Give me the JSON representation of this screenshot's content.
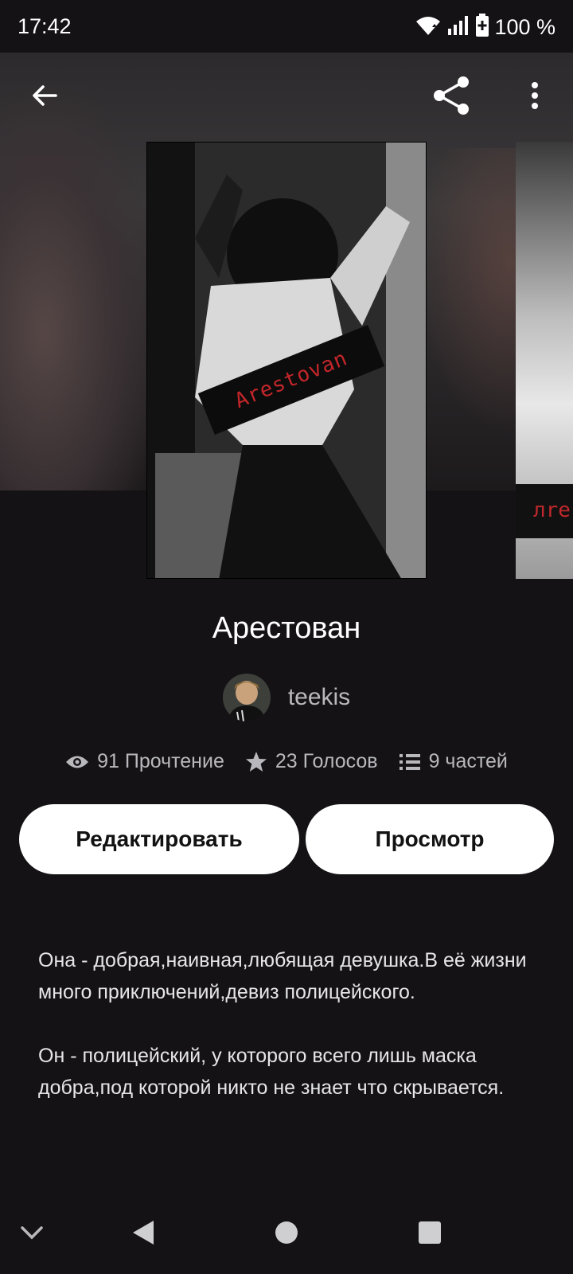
{
  "status_bar": {
    "time": "17:42",
    "battery_text": "100 %",
    "icons": [
      "wifi-icon",
      "cell-signal-icon",
      "battery-icon"
    ]
  },
  "top_nav": {
    "icons": [
      "back-arrow-icon",
      "share-icon",
      "more-vert-icon"
    ]
  },
  "cover": {
    "label": "Arestovan",
    "next_label": "лre"
  },
  "story": {
    "title": "Арестован",
    "author": "teekis"
  },
  "stats": {
    "reads": "91 Прочтение",
    "votes": "23 Голосов",
    "parts": "9 частей",
    "icons": [
      "eye-icon",
      "star-icon",
      "list-icon"
    ]
  },
  "buttons": {
    "edit": "Редактировать",
    "view": "Просмотр"
  },
  "description": {
    "p1": "Она - добрая,наивная,любящая девушка.В её жизни много приключений,девиз полицейского.",
    "p2": "Он - полицейский, у которого всего лишь маска добра,под которой никто не знает что скрывается."
  },
  "nav_bar": {
    "icons": [
      "chevron-down-icon",
      "back-triangle-icon",
      "home-circle-icon",
      "recents-square-icon"
    ]
  },
  "colors": {
    "background": "#141215",
    "text_secondary": "#b9b9bd",
    "button_bg": "#ffffff",
    "cover_label_text": "#c3262a"
  }
}
